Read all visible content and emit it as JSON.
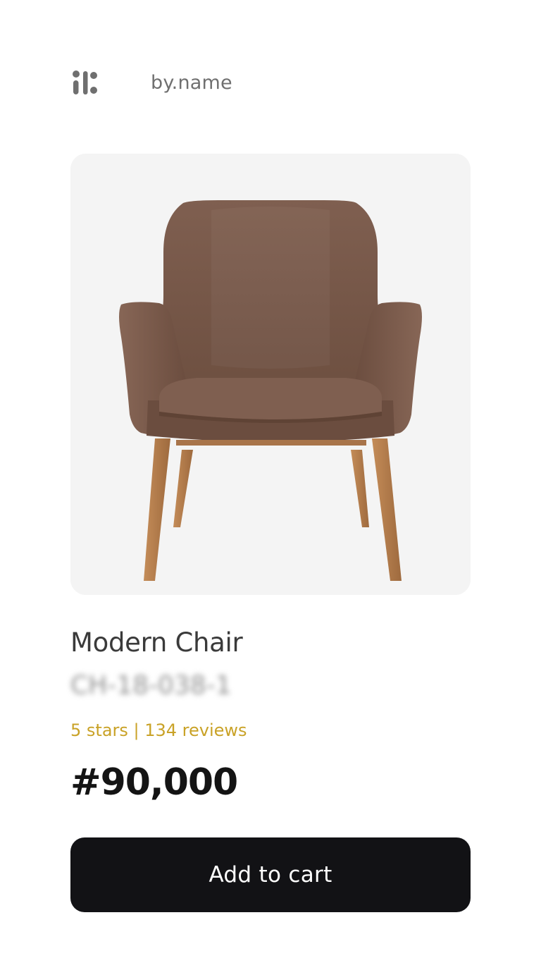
{
  "header": {
    "logo_icon": "grid-dots-logo-icon",
    "brand": "by.name"
  },
  "product": {
    "image": "brown-armchair-photo",
    "title": "Modern Chair",
    "sku": "CH-18-038-1",
    "rating": "5 stars | 134 reviews",
    "price": "#90,000"
  },
  "actions": {
    "add_to_cart": "Add to cart"
  },
  "colors": {
    "rating": "#c9a227",
    "button_bg": "#121215",
    "chair_fabric": "#7b5a4a",
    "chair_legs": "#b27a4a"
  }
}
